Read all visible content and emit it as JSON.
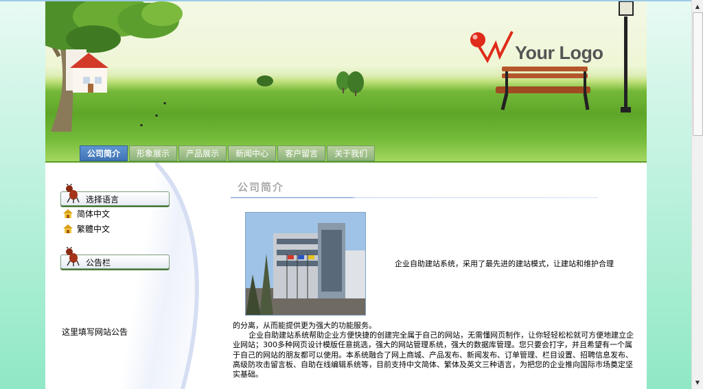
{
  "logo": {
    "text": "Your Logo"
  },
  "nav": {
    "tabs": [
      {
        "label": "公司简介",
        "active": true
      },
      {
        "label": "形象展示",
        "active": false
      },
      {
        "label": "产品展示",
        "active": false
      },
      {
        "label": "新闻中心",
        "active": false
      },
      {
        "label": "客户留言",
        "active": false
      },
      {
        "label": "关于我们",
        "active": false
      }
    ]
  },
  "sidebar": {
    "language_heading": "选择语言",
    "languages": [
      "简体中文",
      "繁體中文"
    ],
    "notice_heading": "公告栏",
    "notice_text": "这里填写网站公告"
  },
  "main": {
    "title": "公司简介",
    "intro_line": "企业自助建站系统，采用了最先进的建站模式，让建站和维护合理",
    "para1_end": "的分离，从而能提供更为强大的功能服务。",
    "para2": "企业自助建站系统帮助企业方便快捷的创建完全属于自己的网站，无需懂网页制作，让你轻轻松松就可方便地建立企业网站；300多种网页设计模版任意挑选，强大的网站管理系统，强大的数据库管理。您只要会打字，并且希望有一个属于自己的网站的朋友都可以使用。本系统融合了网上商城、产品发布、新闻发布、订单管理、栏目设置、招聘信息发布、高级防攻击留言板、自助在线编辑系统等，目前支持中文简体、繁体及英文三种语言，为把您的企业推向国际市场奠定坚实基础。"
  },
  "colors": {
    "page_bg_top": "#e8faf3",
    "page_bg_bottom": "#8fe8c5",
    "nav_active": "#4a80c4",
    "nav_inactive": "#a3c28d",
    "title_gray": "#a9a9a9"
  }
}
